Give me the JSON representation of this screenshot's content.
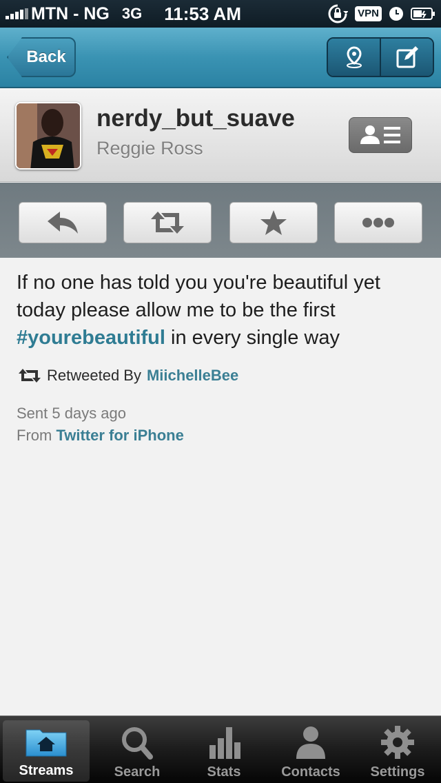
{
  "status_bar": {
    "carrier": "MTN - NG",
    "network": "3G",
    "time": "11:53 AM",
    "vpn": "VPN"
  },
  "nav": {
    "back_label": "Back",
    "buttons": [
      "location-pin-icon",
      "compose-icon"
    ]
  },
  "profile": {
    "username": "nerdy_but_suave",
    "full_name": "Reggie Ross"
  },
  "actions": [
    "reply-icon",
    "retweet-icon",
    "star-icon",
    "more-icon"
  ],
  "tweet": {
    "text_before": "If no one has told you you're beautiful yet today please allow me to be the first ",
    "hashtag": "#yourebeautiful",
    "text_after": " in every single way",
    "retweeted_by_label": "Retweeted By",
    "retweeted_by": "MiichelleBee",
    "sent": "Sent 5 days ago",
    "from_label": "From",
    "from_app": "Twitter for iPhone"
  },
  "tab_bar": {
    "tabs": [
      {
        "label": "Streams",
        "icon": "home-folder-icon",
        "active": true
      },
      {
        "label": "Search",
        "icon": "search-icon",
        "active": false
      },
      {
        "label": "Stats",
        "icon": "bar-chart-icon",
        "active": false
      },
      {
        "label": "Contacts",
        "icon": "person-icon",
        "active": false
      },
      {
        "label": "Settings",
        "icon": "gear-icon",
        "active": false
      }
    ]
  },
  "colors": {
    "nav_accent": "#3a93b3",
    "link": "#3b7f94"
  }
}
